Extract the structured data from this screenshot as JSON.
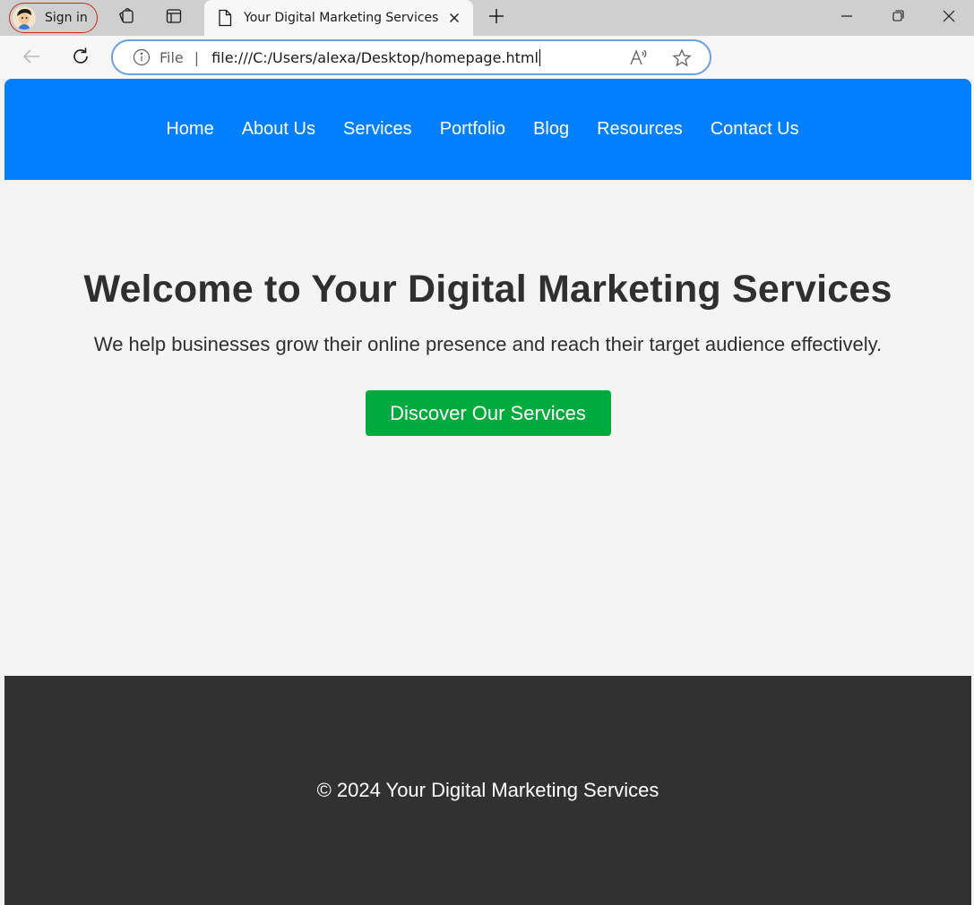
{
  "browser": {
    "signin_label": "Sign in",
    "tab_title": "Your Digital Marketing Services",
    "address_scheme_label": "File",
    "address_separator": "|",
    "url": "file:///C:/Users/alexa/Desktop/homepage.html",
    "icons": [
      "profile-avatar-icon",
      "collections-icon",
      "tab-actions-icon",
      "page-icon",
      "close-icon",
      "new-tab-icon",
      "minimize-icon",
      "restore-icon",
      "window-close-icon",
      "back-icon",
      "refresh-icon",
      "info-icon",
      "read-aloud-icon",
      "favorite-star-icon"
    ]
  },
  "site": {
    "nav": {
      "items": [
        {
          "label": "Home"
        },
        {
          "label": "About Us"
        },
        {
          "label": "Services"
        },
        {
          "label": "Portfolio"
        },
        {
          "label": "Blog"
        },
        {
          "label": "Resources"
        },
        {
          "label": "Contact Us"
        }
      ]
    },
    "hero": {
      "title": "Welcome to Your Digital Marketing Services",
      "subtitle": "We help businesses grow their online presence and reach their target audience effectively.",
      "cta_label": "Discover Our Services"
    },
    "footer": {
      "text": "© 2024 Your Digital Marketing Services"
    }
  },
  "colors": {
    "nav_background": "#0080ff",
    "cta_background": "#00aa3d",
    "footer_background": "#313131",
    "page_background": "#f4f4f4",
    "signin_border": "#c42b1c"
  }
}
